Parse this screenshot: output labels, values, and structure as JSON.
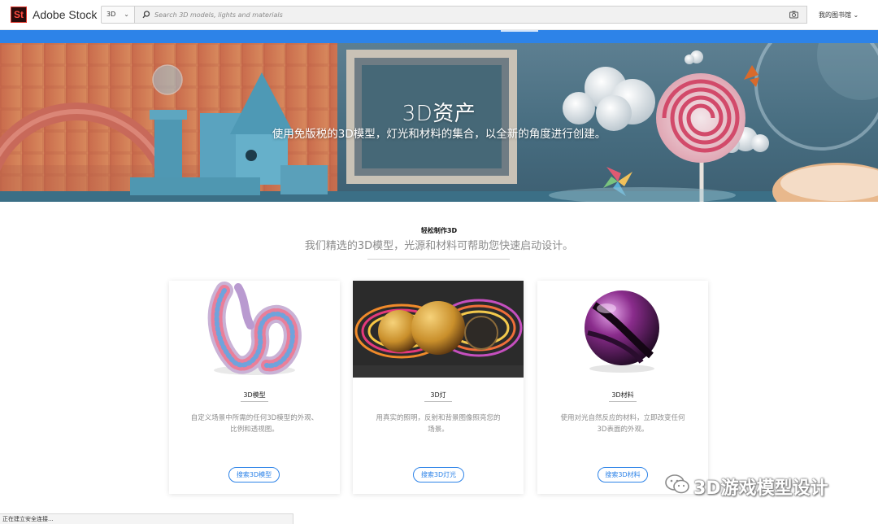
{
  "header": {
    "logo_text": "St",
    "brand": "Adobe Stock",
    "asset_type": "3D",
    "search_placeholder": "Search 3D models, lights and materials",
    "library_label": "我的图书馆"
  },
  "icons": {
    "asset_chevron": "chevron-down-icon",
    "search": "search-icon",
    "camera": "camera-icon",
    "library_chevron": "chevron-down-icon"
  },
  "colors": {
    "accent_blue": "#2d83e8",
    "brand_red": "#e0362c",
    "brand_dark": "#2b0b0b"
  },
  "hero": {
    "title": "3D资产",
    "subtitle": "使用免版税的3D模型，灯光和材料的集合，以全新的角度进行创建。"
  },
  "intro": {
    "kicker": "轻松制作3D",
    "text": "我们精选的3D模型，光源和材料可帮助您快速启动设计。"
  },
  "cards": [
    {
      "title": "3D模型",
      "desc_line1": "自定义场景中所需的任何3D模型的外观、",
      "desc_line2": "比例和透视图。",
      "button": "搜索3D模型"
    },
    {
      "title": "3D灯",
      "desc_line1": "用真实的照明，反射和背景图像照亮您的",
      "desc_line2": "场景。",
      "button": "搜索3D灯光"
    },
    {
      "title": "3D材料",
      "desc_line1": "使用对光自然反应的材料，立即改变任何",
      "desc_line2": "3D表面的外观。",
      "button": "搜索3D材料"
    }
  ],
  "watermark": "3D游戏模型设计",
  "status_text": "正在建立安全连接..."
}
